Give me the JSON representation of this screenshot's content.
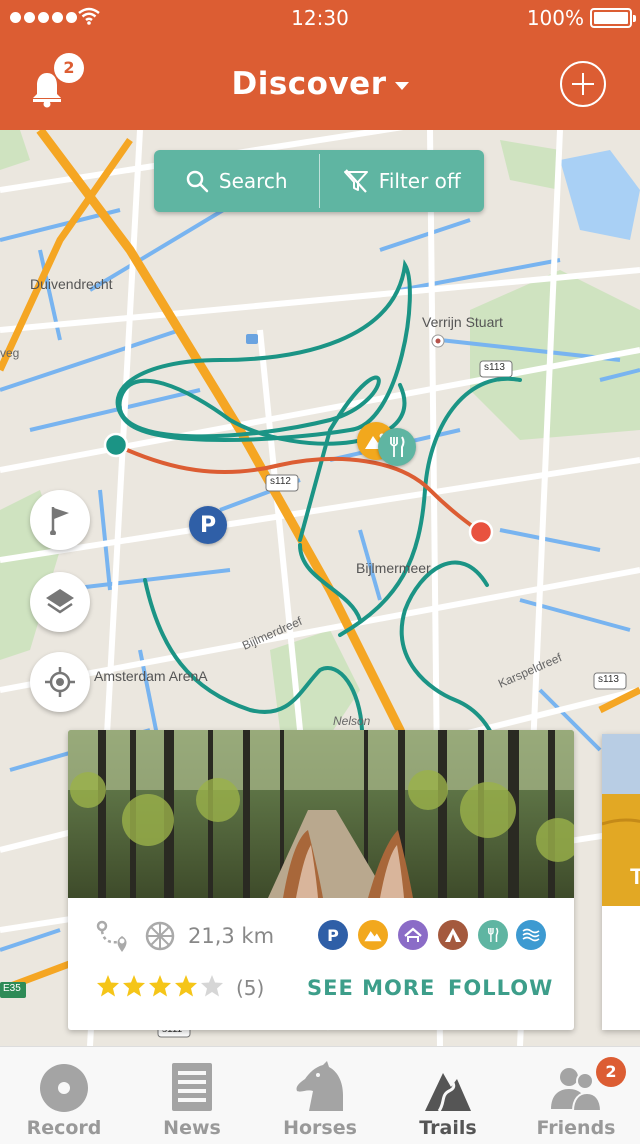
{
  "status": {
    "time": "12:30",
    "battery": "100%"
  },
  "header": {
    "title": "Discover",
    "notification_count": "2"
  },
  "search": {
    "search_label": "Search",
    "filter_label": "Filter off"
  },
  "map": {
    "labels": [
      "Duivendrecht",
      "Verrijn Stuart",
      "Bijlmermeer",
      "Amsterdam ArenA",
      "Bijlmerdreef",
      "Karspeldreef",
      "Nelson",
      "veg"
    ],
    "road_shields": [
      "s113",
      "s112",
      "s113",
      "s111",
      "E35"
    ]
  },
  "trail_card": {
    "distance": "21,3 km",
    "rating": 4,
    "rating_max": 5,
    "rating_count": "(5)",
    "see_more": "SEE MORE",
    "follow": "FOLLOW",
    "amenity_icons": [
      "parking-icon",
      "viewpoint-icon",
      "shelter-icon",
      "camping-icon",
      "restaurant-icon",
      "water-icon"
    ]
  },
  "tabbar": {
    "tabs": [
      {
        "label": "Record"
      },
      {
        "label": "News"
      },
      {
        "label": "Horses"
      },
      {
        "label": "Trails"
      },
      {
        "label": "Friends"
      }
    ],
    "friends_badge": "2"
  },
  "colors": {
    "brand": "#dc5d33",
    "accent": "#5fb5a2",
    "trail_teal": "#1b9485",
    "trail_orange": "#dc5d33"
  }
}
